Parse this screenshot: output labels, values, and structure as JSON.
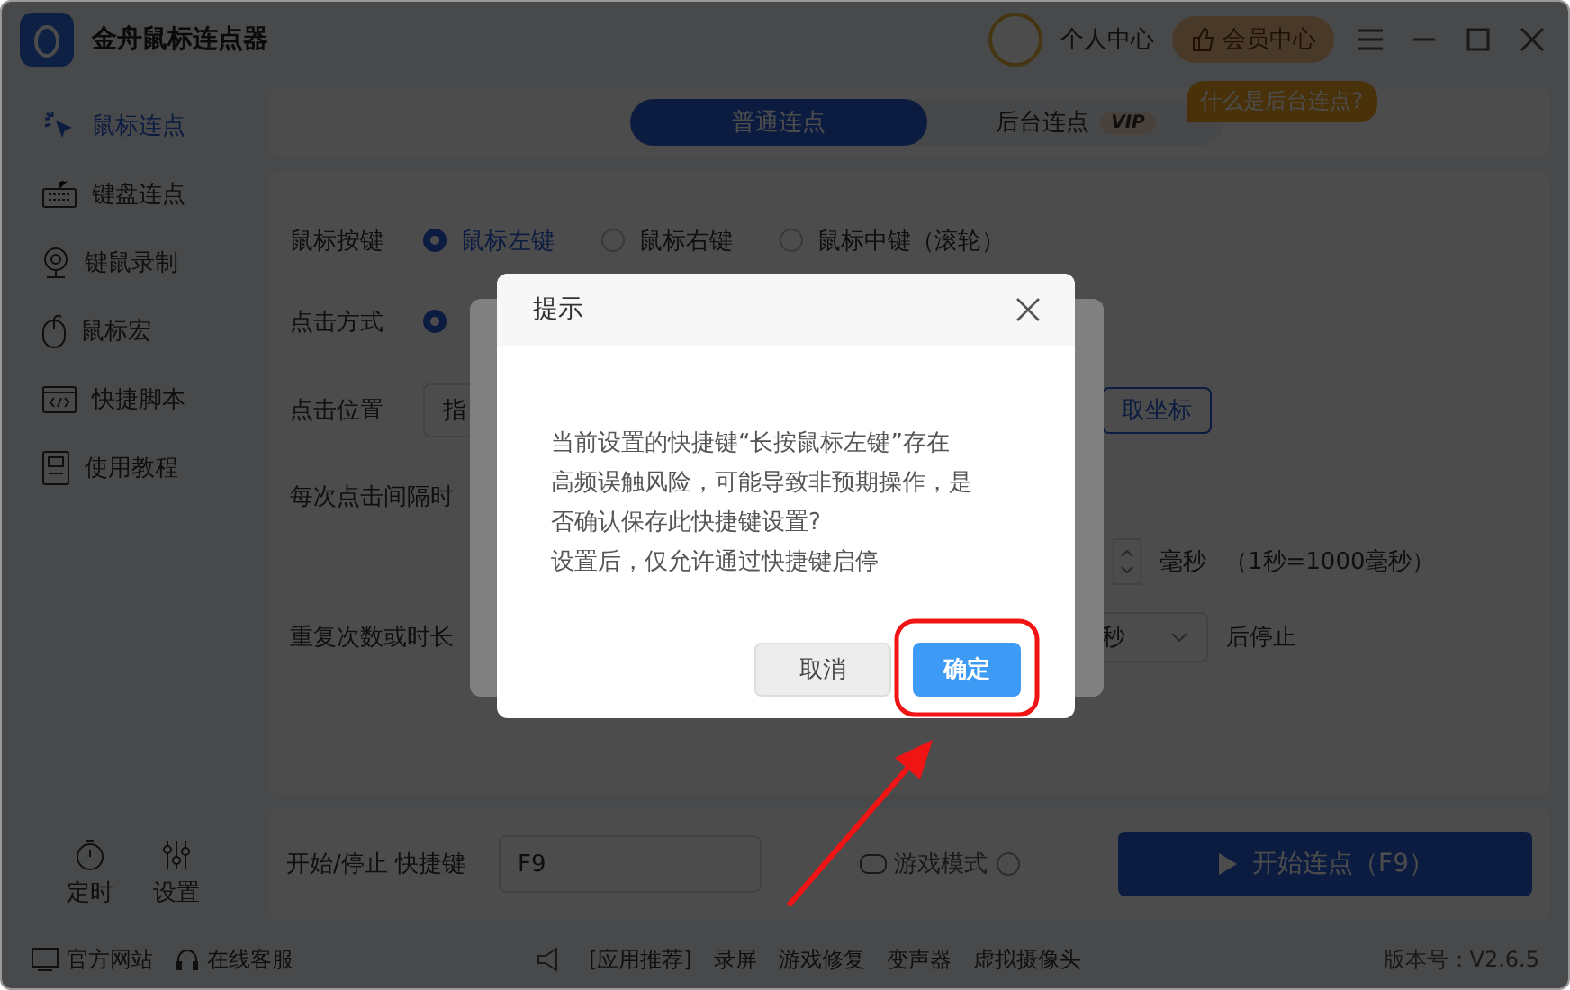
{
  "window": {
    "title": "金舟鼠标连点器",
    "user": "个人中心",
    "vip": "会员中心"
  },
  "sidebar": {
    "items": [
      {
        "label": "鼠标连点",
        "selected": true
      },
      {
        "label": "键盘连点",
        "selected": false
      },
      {
        "label": "键鼠录制",
        "selected": false
      },
      {
        "label": "鼠标宏",
        "selected": false
      },
      {
        "label": "快捷脚本",
        "selected": false
      },
      {
        "label": "使用教程",
        "selected": false
      }
    ],
    "bottom": [
      "定时",
      "设置"
    ]
  },
  "tabs": [
    {
      "label": "普通连点",
      "selected": true
    },
    {
      "label": "后台连点",
      "selected": false,
      "badge": "VIP"
    }
  ],
  "help_tag": "什么是后台连点?",
  "form": {
    "mouse_button": {
      "label": "鼠标按键",
      "options": [
        {
          "label": "鼠标左键",
          "selected": true
        },
        {
          "label": "鼠标右键",
          "selected": false
        },
        {
          "label": "鼠标中键（滚轮）",
          "selected": false
        }
      ]
    },
    "click_mode": {
      "label": "点击方式",
      "selected": true
    },
    "position": {
      "label": "点击位置",
      "value": "指",
      "button": "取坐标"
    },
    "interval": {
      "label": "每次点击间隔时",
      "unit": "毫秒",
      "note": "（1秒=1000毫秒）"
    },
    "repeat": {
      "label": "重复次数或时长",
      "unit": "秒",
      "suffix": "后停止"
    }
  },
  "hotkey_bar": {
    "label": "开始/停止 快捷键",
    "value": "F9",
    "game_mode": "游戏模式",
    "start": "开始连点（F9）"
  },
  "footer": {
    "links": [
      "官方网站",
      "在线客服"
    ],
    "apps": [
      "[应用推荐]",
      "录屏",
      "游戏修复",
      "变声器",
      "虚拟摄像头"
    ],
    "version": "版本号：V2.6.5"
  },
  "dialog": {
    "title": "提示",
    "lines": [
      "当前设置的快捷键“长按鼠标左键”存在",
      "高频误触风险，可能导致非预期操作，是",
      "否确认保存此快捷键设置?",
      "设置后，仅允许通过快捷键启停"
    ],
    "cancel": "取消",
    "confirm": "确定"
  }
}
